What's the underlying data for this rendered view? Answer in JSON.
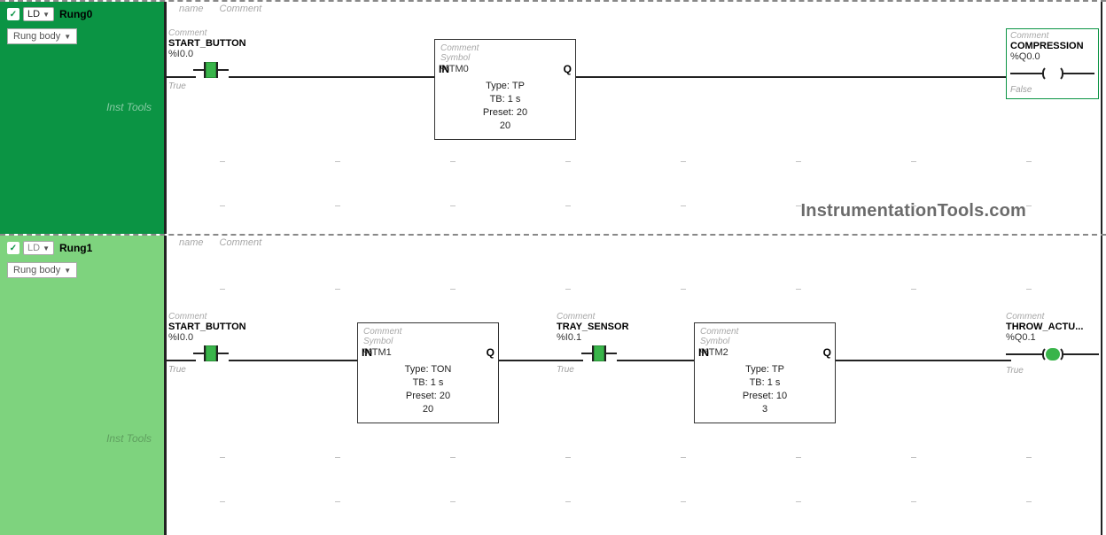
{
  "headers": {
    "name": "name",
    "comment": "Comment"
  },
  "watermark": "InstrumentationTools.com",
  "sidebar": {
    "ld_label": "LD",
    "body_label": "Rung body",
    "inst_tools": "Inst Tools"
  },
  "rungs": [
    {
      "name": "Rung0",
      "active": true,
      "elements": {
        "contact0": {
          "comment": "Comment",
          "symbol": "START_BUTTON",
          "address": "%I0.0",
          "state": "True",
          "energized": true
        },
        "timer0": {
          "comment": "Comment",
          "symbol_hint": "Symbol",
          "symbol": "%TM0",
          "in": "IN",
          "q": "Q",
          "type_lbl": "Type:",
          "type": "TP",
          "tb_lbl": "TB:",
          "tb": "1 s",
          "preset_lbl": "Preset:",
          "preset": "20",
          "current": "20"
        },
        "coil0": {
          "comment": "Comment",
          "symbol": "COMPRESSION",
          "address": "%Q0.0",
          "state": "False",
          "energized": false,
          "selected": true
        }
      }
    },
    {
      "name": "Rung1",
      "active": false,
      "elements": {
        "contact0": {
          "comment": "Comment",
          "symbol": "START_BUTTON",
          "address": "%I0.0",
          "state": "True",
          "energized": true
        },
        "timer0": {
          "comment": "Comment",
          "symbol_hint": "Symbol",
          "symbol": "%TM1",
          "in": "IN",
          "q": "Q",
          "type_lbl": "Type:",
          "type": "TON",
          "tb_lbl": "TB:",
          "tb": "1 s",
          "preset_lbl": "Preset:",
          "preset": "20",
          "current": "20"
        },
        "contact1": {
          "comment": "Comment",
          "symbol": "TRAY_SENSOR",
          "address": "%I0.1",
          "state": "True",
          "energized": true
        },
        "timer1": {
          "comment": "Comment",
          "symbol_hint": "Symbol",
          "symbol": "%TM2",
          "in": "IN",
          "q": "Q",
          "type_lbl": "Type:",
          "type": "TP",
          "tb_lbl": "TB:",
          "tb": "1 s",
          "preset_lbl": "Preset:",
          "preset": "10",
          "current": "3"
        },
        "coil0": {
          "comment": "Comment",
          "symbol": "THROW_ACTU...",
          "address": "%Q0.1",
          "state": "True",
          "energized": true,
          "selected": false
        }
      }
    }
  ]
}
